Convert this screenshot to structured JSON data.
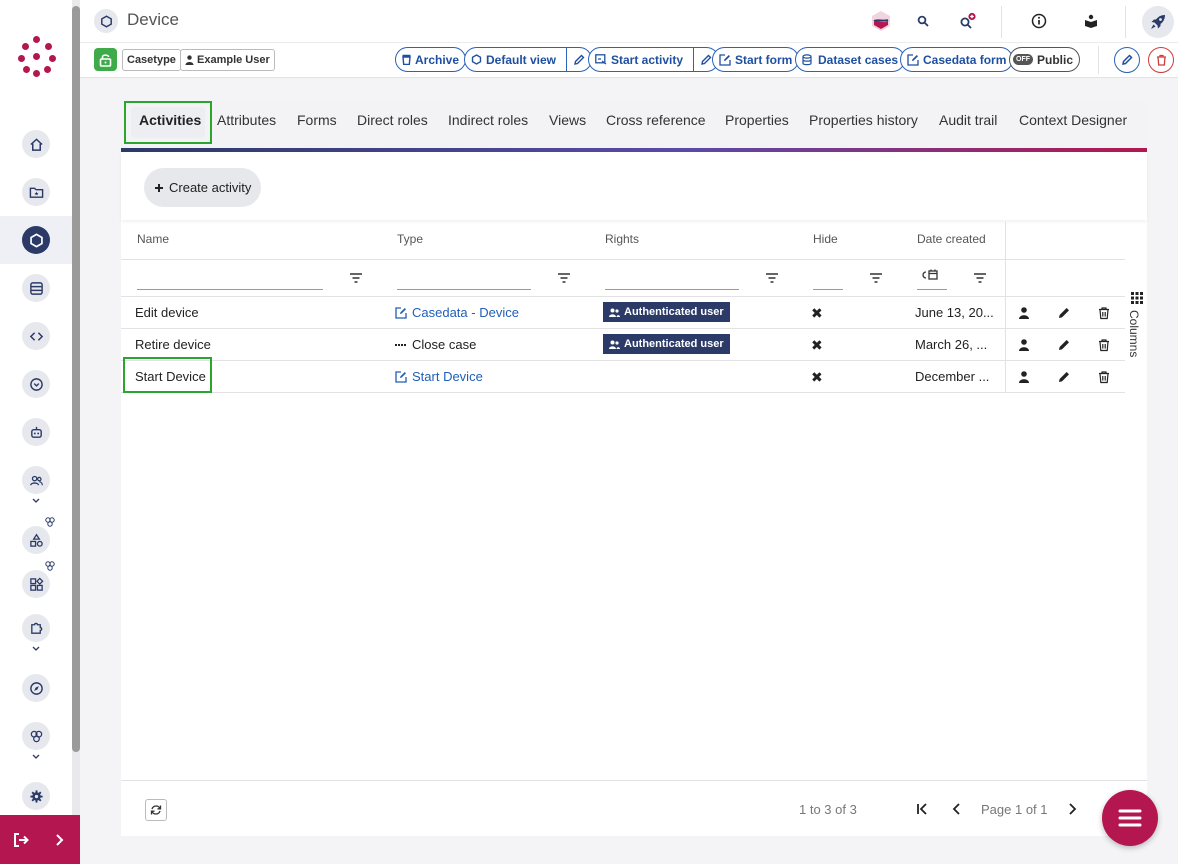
{
  "header": {
    "title": "Device",
    "chips": {
      "casetype": "Casetype",
      "user": "Example User"
    },
    "actions": {
      "archive": "Archive",
      "default_view": "Default view",
      "start_activity": "Start activity",
      "start_form": "Start form",
      "dataset_cases": "Dataset cases",
      "casedata_form": "Casedata form",
      "public_toggle": "OFF",
      "public": "Public"
    }
  },
  "tabs": [
    "Activities",
    "Attributes",
    "Forms",
    "Direct roles",
    "Indirect roles",
    "Views",
    "Cross reference",
    "Properties",
    "Properties history",
    "Audit trail",
    "Context Designer"
  ],
  "toolbar": {
    "create_activity": "Create activity"
  },
  "table": {
    "columns": [
      "Name",
      "Type",
      "Rights",
      "Hide",
      "Date created"
    ],
    "rows": [
      {
        "name": "Edit device",
        "type": "Casedata - Device",
        "rights": "Authenticated user",
        "hide": "✖",
        "date": "June 13, 20..."
      },
      {
        "name": "Retire device",
        "type": "Close case",
        "rights": "Authenticated user",
        "hide": "✖",
        "date": "March 26, ..."
      },
      {
        "name": "Start Device",
        "type": "Start Device",
        "rights": "",
        "hide": "✖",
        "date": "December ..."
      }
    ],
    "columns_panel": "Columns"
  },
  "footer": {
    "range": "1 to 3 of 3",
    "page": "Page 1 of 1"
  },
  "colors": {
    "brand": "#b4174f",
    "navy": "#2b3a67",
    "link": "#1f5fb8",
    "highlight": "#2aa52e"
  }
}
